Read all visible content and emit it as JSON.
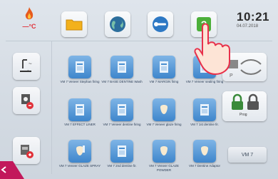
{
  "header": {
    "temp_unit": "—°C",
    "time": "10:21",
    "date": "04.07.2018",
    "toolbar_icons": [
      "folder-icon",
      "globe-icon",
      "wrench-icon",
      "help-icon"
    ]
  },
  "sidebar": {
    "items": [
      "temperature-unit-icon",
      "dryer-icon",
      "muffle-icon",
      "cooling-icon"
    ]
  },
  "programs": [
    {
      "label": "VM 7 Veneer Stephan firing"
    },
    {
      "label": "VM 7 BASE DENTINE Wash"
    },
    {
      "label": "VM 7 MARGIN firing"
    },
    {
      "label": "VM 7 Veneer sealing firing"
    },
    {
      "label": "VM 7 EFFECT LINER"
    },
    {
      "label": "VM 7 Veneer dentine firing"
    },
    {
      "label": "VM 7 Veneer glaze firing"
    },
    {
      "label": "VM 7 1st dentine fir."
    },
    {
      "label": "VM 7 Veneer GLAZE SPRAY"
    },
    {
      "label": "VM 7 2nd dentine fir."
    },
    {
      "label": "VM 7 Veneer GLAZE POWDER"
    },
    {
      "label": "VM 7 Dentine Adaptor"
    }
  ],
  "right_panel": {
    "vm_label": "VM 7",
    "lock_label": "Prog"
  },
  "colors": {
    "accent_red": "#e0323a",
    "program_blue": "#4a8fd0",
    "help_green": "#4caf3a",
    "corner_magenta": "#c2185b"
  }
}
